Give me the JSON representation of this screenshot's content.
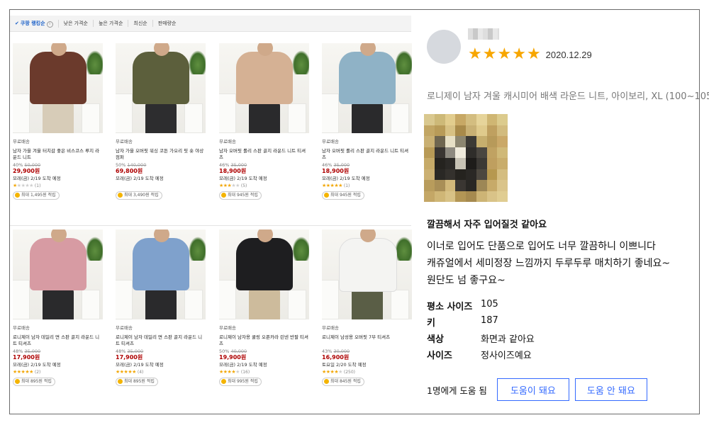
{
  "sort_bar": {
    "items": [
      "쿠팡 랭킹순",
      "낮은 가격순",
      "높은 가격순",
      "최신순",
      "판매량순"
    ],
    "active_index": 0
  },
  "products": [
    {
      "shipping": "무료배송",
      "name": "남자 가을 겨울 터치감 좋은 비스코스 루지 라운드 니트",
      "discount": "40%",
      "original": "50,000",
      "price": "29,900원",
      "delivery": "모레(금) 2/19 도착 예정",
      "rating": 1,
      "reviews": "(1)",
      "reward": "최대 1,495원 적립",
      "colors": {
        "torso": "#6b3a2c",
        "pants": "#d7ccb8"
      }
    },
    {
      "shipping": "무료배송",
      "name": "남자 가을 오버핏 워싱 코튼 가오리 핏 숏 야상 점퍼",
      "discount": "50%",
      "original": "140,000",
      "price": "69,800원",
      "delivery": "모레(금) 2/19 도착 예정",
      "rating": 0,
      "reviews": "",
      "reward": "최대 3,490원 적립",
      "colors": {
        "torso": "#5c5f3c",
        "pants": "#2d2d2f"
      }
    },
    {
      "shipping": "무료배송",
      "name": "남자 오버핏 롤리 스판 골지 라운드 니트 티셔츠",
      "discount": "46%",
      "original": "35,000",
      "price": "18,900원",
      "delivery": "모레(금) 2/19 도착 예정",
      "rating": 3.5,
      "reviews": "(5)",
      "reward": "최대 945원 적립",
      "colors": {
        "torso": "#d5b194",
        "pants": "#2a2a2c"
      }
    },
    {
      "shipping": "무료배송",
      "name": "남자 오버핏 롤리 스판 골지 라운드 니트 티셔츠",
      "discount": "46%",
      "original": "35,000",
      "price": "18,900원",
      "delivery": "모레(금) 2/19 도착 예정",
      "rating": 5,
      "reviews": "(1)",
      "reward": "최대 945원 적립",
      "colors": {
        "torso": "#8fb2c6",
        "pants": "#2a2a2c"
      }
    },
    {
      "shipping": "무료배송",
      "name": "로니제이 남자 데일리 면 스판 골지 라운드 니트 티셔츠",
      "discount": "48%",
      "original": "35,000",
      "price": "17,900원",
      "delivery": "모레(금) 2/19 도착 예정",
      "rating": 5,
      "reviews": "(2)",
      "reward": "최대 895원 적립",
      "colors": {
        "torso": "#d79ba3",
        "pants": "#2a2a2c"
      }
    },
    {
      "shipping": "무료배송",
      "name": "로니제이 남자 데일리 면 스판 골지 라운드 니트 티셔츠",
      "discount": "48%",
      "original": "35,000",
      "price": "17,900원",
      "delivery": "모레(금) 2/19 도착 예정",
      "rating": 5,
      "reviews": "(4)",
      "reward": "최대 895원 적립",
      "colors": {
        "torso": "#7fa1cc",
        "pants": "#2a2a2c"
      }
    },
    {
      "shipping": "무료배송",
      "name": "로니제이 남자용 쿨링 오픈카라 린넨 반팔 티셔츠",
      "discount": "50%",
      "original": "40,000",
      "price": "19,900원",
      "delivery": "모레(금) 2/19 도착 예정",
      "rating": 4,
      "reviews": "(16)",
      "reward": "최대 995원 적립",
      "colors": {
        "torso": "#1e1e20",
        "pants": "#cdbb9c"
      }
    },
    {
      "shipping": "무료배송",
      "name": "로니제이 남성용 오버핏 7부 티셔츠",
      "discount": "43%",
      "original": "30,000",
      "price": "16,900원",
      "delivery": "토요일 2/20 도착 예정",
      "rating": 4.5,
      "reviews": "(250)",
      "reward": "최대 845원 적립",
      "colors": {
        "torso": "#f4f4f2",
        "pants": "#5a5e46"
      }
    }
  ],
  "review": {
    "date": "2020.12.29",
    "stars": 5,
    "product_name": "로니제이 남자 겨울 캐시미어 배색 라운드 니트, 아이보리, XL (100~105)",
    "headline": "깔끔해서 자주 입어질것 같아요",
    "body": [
      "이너로 입어도 단품으로 입어도 너무 깔끔하니 이쁘니다",
      "캐쥬얼에서 세미정장 느낌까지 두루두루 매치하기 좋네요~",
      "원단도 넘 좋구요~"
    ],
    "specs": [
      {
        "key": "평소 사이즈",
        "value": "105"
      },
      {
        "key": "키",
        "value": "187"
      },
      {
        "key": "색상",
        "value": "화면과 같아요"
      },
      {
        "key": "사이즈",
        "value": "정사이즈예요"
      }
    ],
    "helpful_text": "1명에게 도움 됨",
    "helpful_button": "도움이 돼요",
    "not_helpful_button": "도움 안 돼요"
  },
  "colors": {
    "accent_blue": "#346aff",
    "star": "#f7a600",
    "price_red": "#ae0000"
  }
}
